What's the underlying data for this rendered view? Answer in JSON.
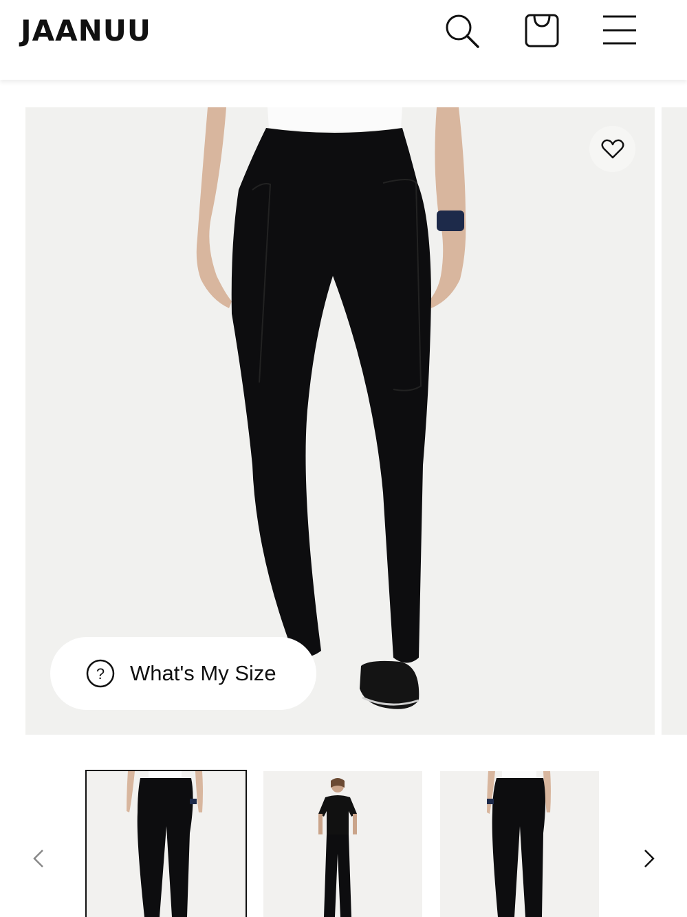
{
  "header": {
    "logo": "JAANUU",
    "icons": {
      "search": "search-icon",
      "bag": "shopping-bag-icon",
      "menu": "hamburger-menu-icon"
    }
  },
  "product_gallery": {
    "main_image": {
      "subject": "black flare scrub pants"
    },
    "favorite_icon": "heart-icon",
    "size_helper": {
      "icon": "question-circle-icon",
      "label": "What's My Size"
    }
  },
  "thumbnails": {
    "items": [
      {
        "name": "front view",
        "selected": true
      },
      {
        "name": "full outfit view",
        "selected": false
      },
      {
        "name": "back view",
        "selected": false
      }
    ],
    "prev_icon": "chevron-left-icon",
    "next_icon": "chevron-right-icon"
  },
  "colors": {
    "background": "#ffffff",
    "image_bg": "#f1f1ef",
    "text": "#111111",
    "garment": "#0d0d0f"
  }
}
